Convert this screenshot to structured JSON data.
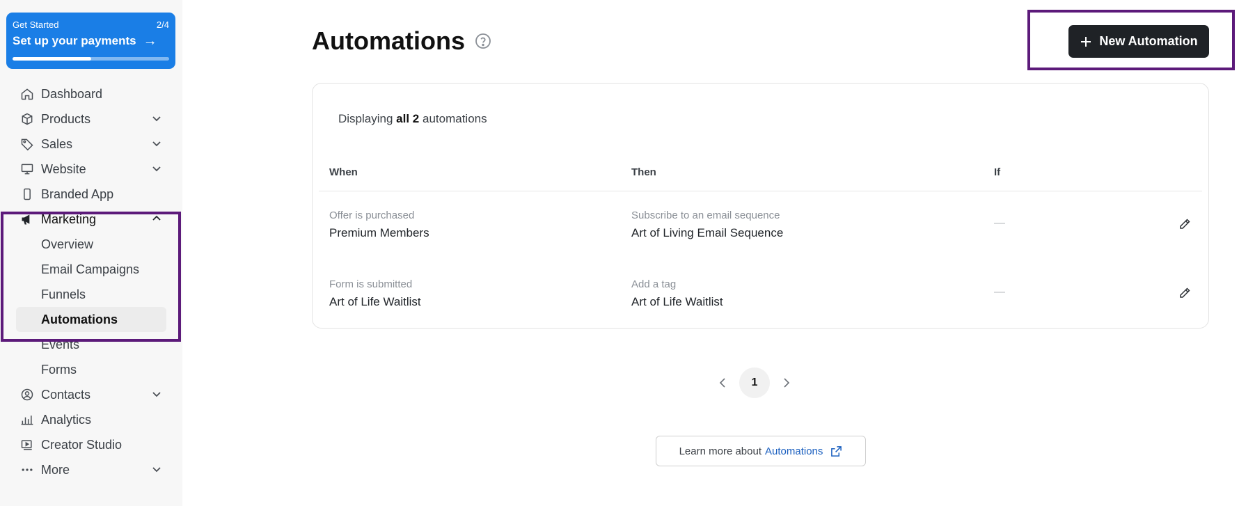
{
  "get_started": {
    "label": "Get Started",
    "progress_text": "2/4",
    "title": "Set up your payments",
    "progress_fraction": 0.5
  },
  "sidebar": {
    "items": [
      {
        "label": "Dashboard",
        "icon": "home-icon"
      },
      {
        "label": "Products",
        "icon": "box-icon",
        "expandable": true
      },
      {
        "label": "Sales",
        "icon": "tag-icon",
        "expandable": true
      },
      {
        "label": "Website",
        "icon": "monitor-icon",
        "expandable": true
      },
      {
        "label": "Branded App",
        "icon": "phone-icon"
      },
      {
        "label": "Marketing",
        "icon": "megaphone-icon",
        "expanded": true
      },
      {
        "label": "Contacts",
        "icon": "user-circle-icon",
        "expandable": true
      },
      {
        "label": "Analytics",
        "icon": "bar-chart-icon"
      },
      {
        "label": "Creator Studio",
        "icon": "video-icon"
      },
      {
        "label": "More",
        "icon": "dots-icon",
        "expandable": true
      }
    ],
    "marketing_sub": [
      "Overview",
      "Email Campaigns",
      "Funnels",
      "Automations",
      "Events",
      "Forms"
    ],
    "selected_sub": "Automations"
  },
  "page": {
    "title": "Automations",
    "new_button": "New Automation"
  },
  "table": {
    "display_prefix": "Displaying",
    "display_bold": "all 2",
    "display_suffix": "automations",
    "headers": {
      "when": "When",
      "then": "Then",
      "if": "If"
    },
    "rows": [
      {
        "when_sub": "Offer is purchased",
        "when_main": "Premium Members",
        "then_sub": "Subscribe to an email sequence",
        "then_main": "Art of Living Email Sequence",
        "if": "—"
      },
      {
        "when_sub": "Form is submitted",
        "when_main": "Art of Life Waitlist",
        "then_sub": "Add a tag",
        "then_main": "Art of Life Waitlist",
        "if": "—"
      }
    ]
  },
  "pagination": {
    "current": "1"
  },
  "learn": {
    "prefix": "Learn more about",
    "link": "Automations"
  },
  "colors": {
    "accent": "#1a7ee6",
    "highlight": "#5c1a7a",
    "button_dark": "#1f2226"
  }
}
